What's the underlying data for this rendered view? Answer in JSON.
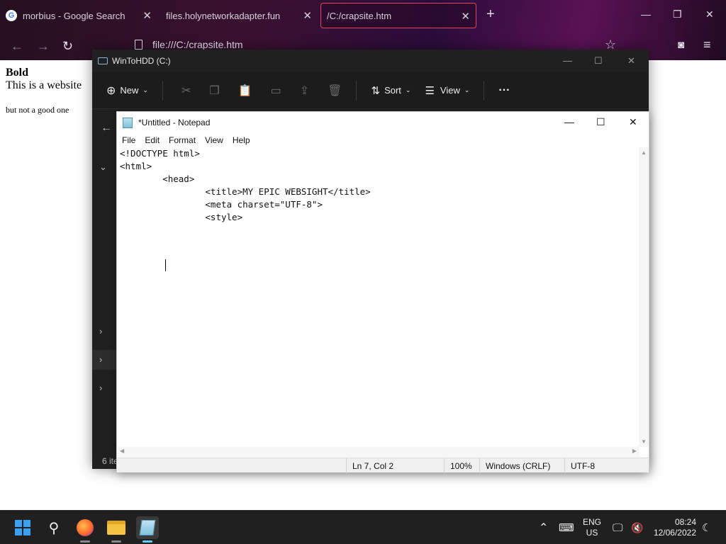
{
  "browser": {
    "tabs": [
      {
        "label": "morbius - Google Search",
        "icon": "google-icon",
        "active": false
      },
      {
        "label": "files.holynetworkadapter.fun",
        "icon": "",
        "active": false
      },
      {
        "label": "/C:/crapsite.htm",
        "icon": "",
        "active": true
      }
    ],
    "url": "file:///C:/crapsite.htm"
  },
  "page": {
    "bold": "Bold",
    "line1": "This is a website",
    "line2": "but not a good one"
  },
  "explorer": {
    "title": "WinToHDD (C:)",
    "toolbar": {
      "new": "New",
      "sort": "Sort",
      "view": "View",
      "more": "···"
    },
    "status": "6 ite"
  },
  "notepad": {
    "title": "*Untitled - Notepad",
    "menu": [
      "File",
      "Edit",
      "Format",
      "View",
      "Help"
    ],
    "lines": [
      "<!DOCTYPE html>",
      "<html>",
      "        <head>",
      "                <title>MY EPIC WEBSIGHT</title>",
      "                <meta charset=\"UTF-8\">",
      "                <style>",
      "        "
    ],
    "status": {
      "position": "Ln 7, Col 2",
      "zoom": "100%",
      "line_ending": "Windows (CRLF)",
      "encoding": "UTF-8"
    }
  },
  "taskbar": {
    "lang": "ENG",
    "region": "US",
    "time": "08:24",
    "date": "12/06/2022"
  },
  "colors": {
    "accent_tab_border": "#e0445e",
    "taskbar_active": "#60cdff"
  }
}
